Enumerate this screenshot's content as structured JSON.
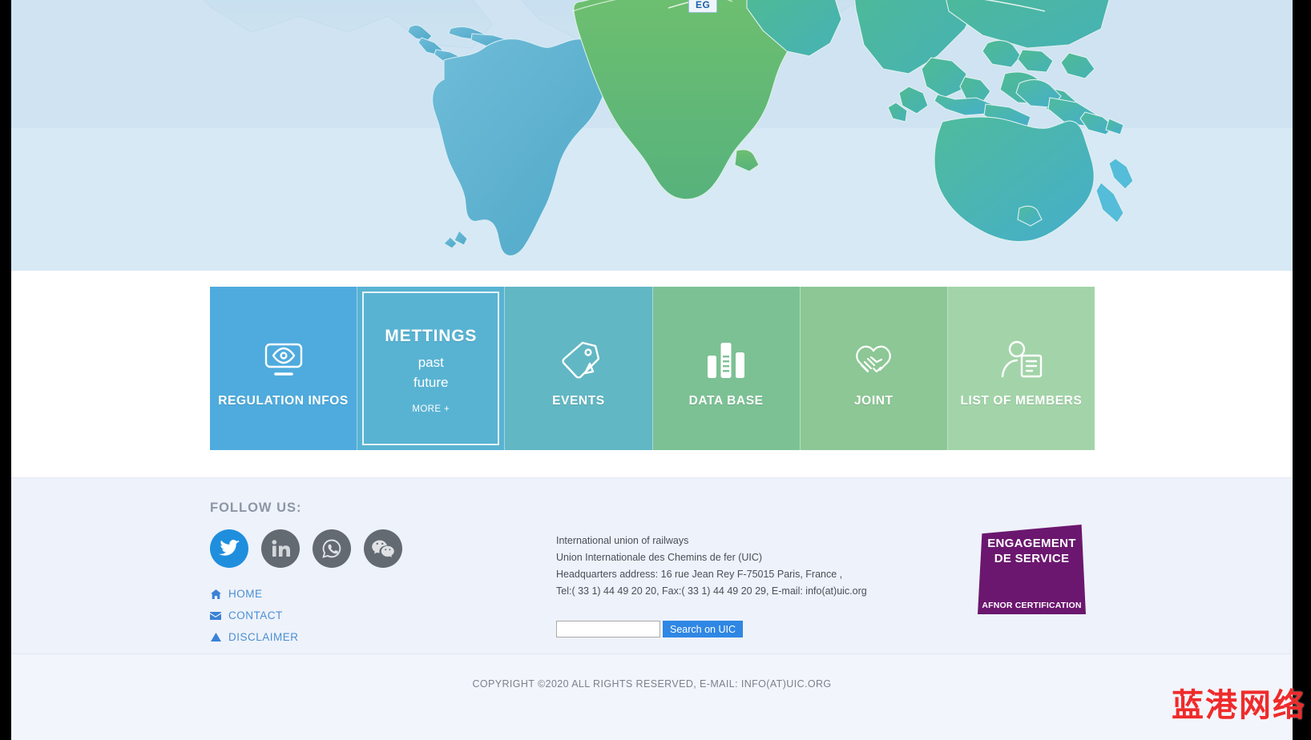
{
  "hero": {
    "map_label": "EG",
    "ocean_color": "#cfe3f2",
    "americas_color": "#5cb3d0",
    "africa_color": "#64b96e",
    "asia_color": "#4bb5a0"
  },
  "tiles": [
    {
      "id": "regulation-infos",
      "label": "REGULATION INFOS",
      "icon": "monitor-eye-icon",
      "color": "#4fabdd",
      "active": false
    },
    {
      "id": "mettings",
      "label": "METTINGS",
      "sub1": "past",
      "sub2": "future",
      "more": "MORE +",
      "icon": "none",
      "color": "#58b3d2",
      "active": true
    },
    {
      "id": "events",
      "label": "EVENTS",
      "icon": "tag-icon",
      "color": "#62b7c4",
      "active": false
    },
    {
      "id": "data-base",
      "label": "DATA BASE",
      "icon": "bar-chart-icon",
      "color": "#7cc194",
      "active": false
    },
    {
      "id": "joint",
      "label": "JOINT",
      "icon": "handshake-icon",
      "color": "#8cc795",
      "active": false
    },
    {
      "id": "list-of-members",
      "label": "LIST OF MEMBERS",
      "icon": "member-card-icon",
      "color": "#a3d4a9",
      "active": false
    }
  ],
  "footer": {
    "follow_title": "FOLLOW US:",
    "social": [
      {
        "id": "twitter",
        "icon": "twitter-icon",
        "color": "#1f8fdd"
      },
      {
        "id": "linkedin",
        "icon": "linkedin-icon",
        "color": "#636a72"
      },
      {
        "id": "whatsapp",
        "icon": "whatsapp-icon",
        "color": "#636a72"
      },
      {
        "id": "wechat",
        "icon": "wechat-icon",
        "color": "#636a72"
      }
    ],
    "links": [
      {
        "id": "home",
        "label": "HOME",
        "icon": "home-icon"
      },
      {
        "id": "contact",
        "label": "CONTACT",
        "icon": "mail-icon"
      },
      {
        "id": "disclaimer",
        "label": "DISCLAIMER",
        "icon": "warning-triangle-icon"
      }
    ],
    "address": [
      "International union of railways",
      "Union Internationale des Chemins de fer (UIC)",
      "Headquarters address: 16 rue Jean Rey F-75015 Paris, France ,",
      "Tel:( 33 1) 44 49 20 20, Fax:( 33 1) 44 49 20 29, E-mail: info(at)uic.org"
    ],
    "search": {
      "value": "",
      "placeholder": "",
      "button_label": "Search on UIC"
    },
    "badge": {
      "line1": "ENGAGEMENT",
      "line2": "DE SERVICE",
      "line3": "AFNOR CERTIFICATION",
      "color": "#6b176f"
    }
  },
  "copyright": {
    "text": "COPYRIGHT ©2020  ALL RIGHTS RESERVED, E-MAIL: INFO(AT)UIC.ORG"
  },
  "watermark": {
    "text": "蓝港网络",
    "color": "#ef2b2b"
  }
}
